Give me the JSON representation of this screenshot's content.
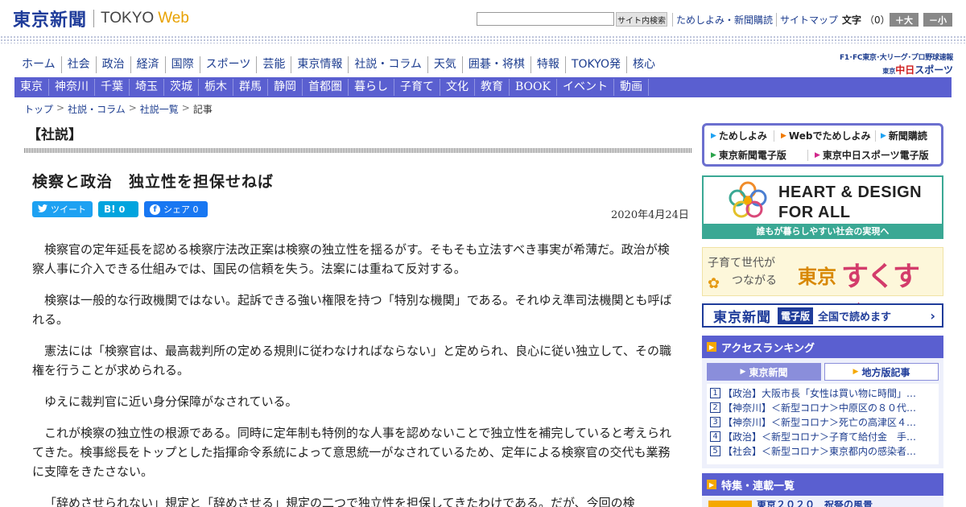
{
  "header": {
    "logo_jp": "東京新聞",
    "logo_tokyo": "TOKYO",
    "logo_web": "Web",
    "search_placeholder": "",
    "search_button": "サイト内検索",
    "links": [
      "ためしよみ・新聞購読",
      "サイトマップ"
    ],
    "font_size_label": "文字",
    "font_size_count": "（0）",
    "font_bigger": "＋大",
    "font_smaller": "－小"
  },
  "main_nav": [
    "ホーム",
    "社会",
    "政治",
    "経済",
    "国際",
    "スポーツ",
    "芸能",
    "東京情報",
    "社説・コラム",
    "天気",
    "囲碁・将棋",
    "特報",
    "TOKYO発",
    "核心"
  ],
  "sports_banner": {
    "line1": "F1･FC東京･大リーグ･プロ野球速報",
    "line2_small": "東京",
    "line2_red": "中日",
    "line2_rest": "スポーツ"
  },
  "sub_nav": [
    "東京",
    "神奈川",
    "千葉",
    "埼玉",
    "茨城",
    "栃木",
    "群馬",
    "静岡",
    "首都圏",
    "暮らし",
    "子育て",
    "文化",
    "教育",
    "BOOK",
    "イベント",
    "動画"
  ],
  "breadcrumb": {
    "items": [
      "トップ",
      "社説・コラム",
      "社説一覧"
    ],
    "current": "記事"
  },
  "article": {
    "section": "【社説】",
    "headline": "検察と政治　独立性を担保せねば",
    "date": "2020年4月24日",
    "share": {
      "tweet": "ツイート",
      "hatena_count": "0",
      "facebook": "シェア 0"
    },
    "paragraphs": [
      "検察官の定年延長を認める検察庁法改正案は検察の独立性を揺るがす。そもそも立法すべき事実が希薄だ。政治が検察人事に介入できる仕組みでは、国民の信頼を失う。法案には重ねて反対する。",
      "検察は一般的な行政機関ではない。起訴できる強い権限を持つ「特別な機関」である。それゆえ準司法機関とも呼ばれる。",
      "憲法には「検察官は、最高裁判所の定める規則に従わなければならない」と定められ、良心に従い独立して、その職権を行うことが求められる。",
      "ゆえに裁判官に近い身分保障がなされている。",
      "これが検察の独立性の根源である。同時に定年制も特例的な人事を認めないことで独立性を補完していると考えられてきた。検事総長をトップとした指揮命令系統によって意思統一がなされているため、定年による検察官の交代も業務に支障をきたさない。",
      "「辞めさせられない」規定と「辞めさせる」規定の二つで独立性を担保してきたわけである。だが、今回の検"
    ]
  },
  "sidebar": {
    "promo_links": [
      "ためしよみ",
      "Webでためしよみ",
      "新聞購読",
      "東京新聞電子版",
      "東京中日スポーツ電子版"
    ],
    "heart_banner": {
      "line1": "HEART & DESIGN",
      "line2": "FOR ALL",
      "caption": "誰もが暮らしやすい社会の実現へ"
    },
    "sukusuku_banner": {
      "line1": "子育て世代が",
      "line2": "つながる",
      "brand1": "東京",
      "brand2": "すくすく"
    },
    "digital_banner": {
      "name": "東京新聞",
      "tag": "電子版",
      "text": "全国で読めます"
    },
    "ranking": {
      "title": "アクセスランキング",
      "tab1": "東京新聞",
      "tab2": "地方版記事",
      "items": [
        "【政治】大阪市長「女性は買い物に時間」…",
        "【神奈川】＜新型コロナ＞中原区の８０代…",
        "【神奈川】＜新型コロナ＞死亡の高津区４…",
        "【政治】＜新型コロナ＞子育て給付金　手…",
        "【社会】＜新型コロナ＞東京都内の感染者…"
      ]
    },
    "features": {
      "title": "特集・連載一覧",
      "preview": "東京２０２０　祝祭の風景"
    }
  },
  "colors": {
    "brand_navy": "#1f3c9a",
    "nav_purple": "#5a5fd0",
    "accent_orange": "#f5a800",
    "link_blue": "#1d3d8f"
  }
}
